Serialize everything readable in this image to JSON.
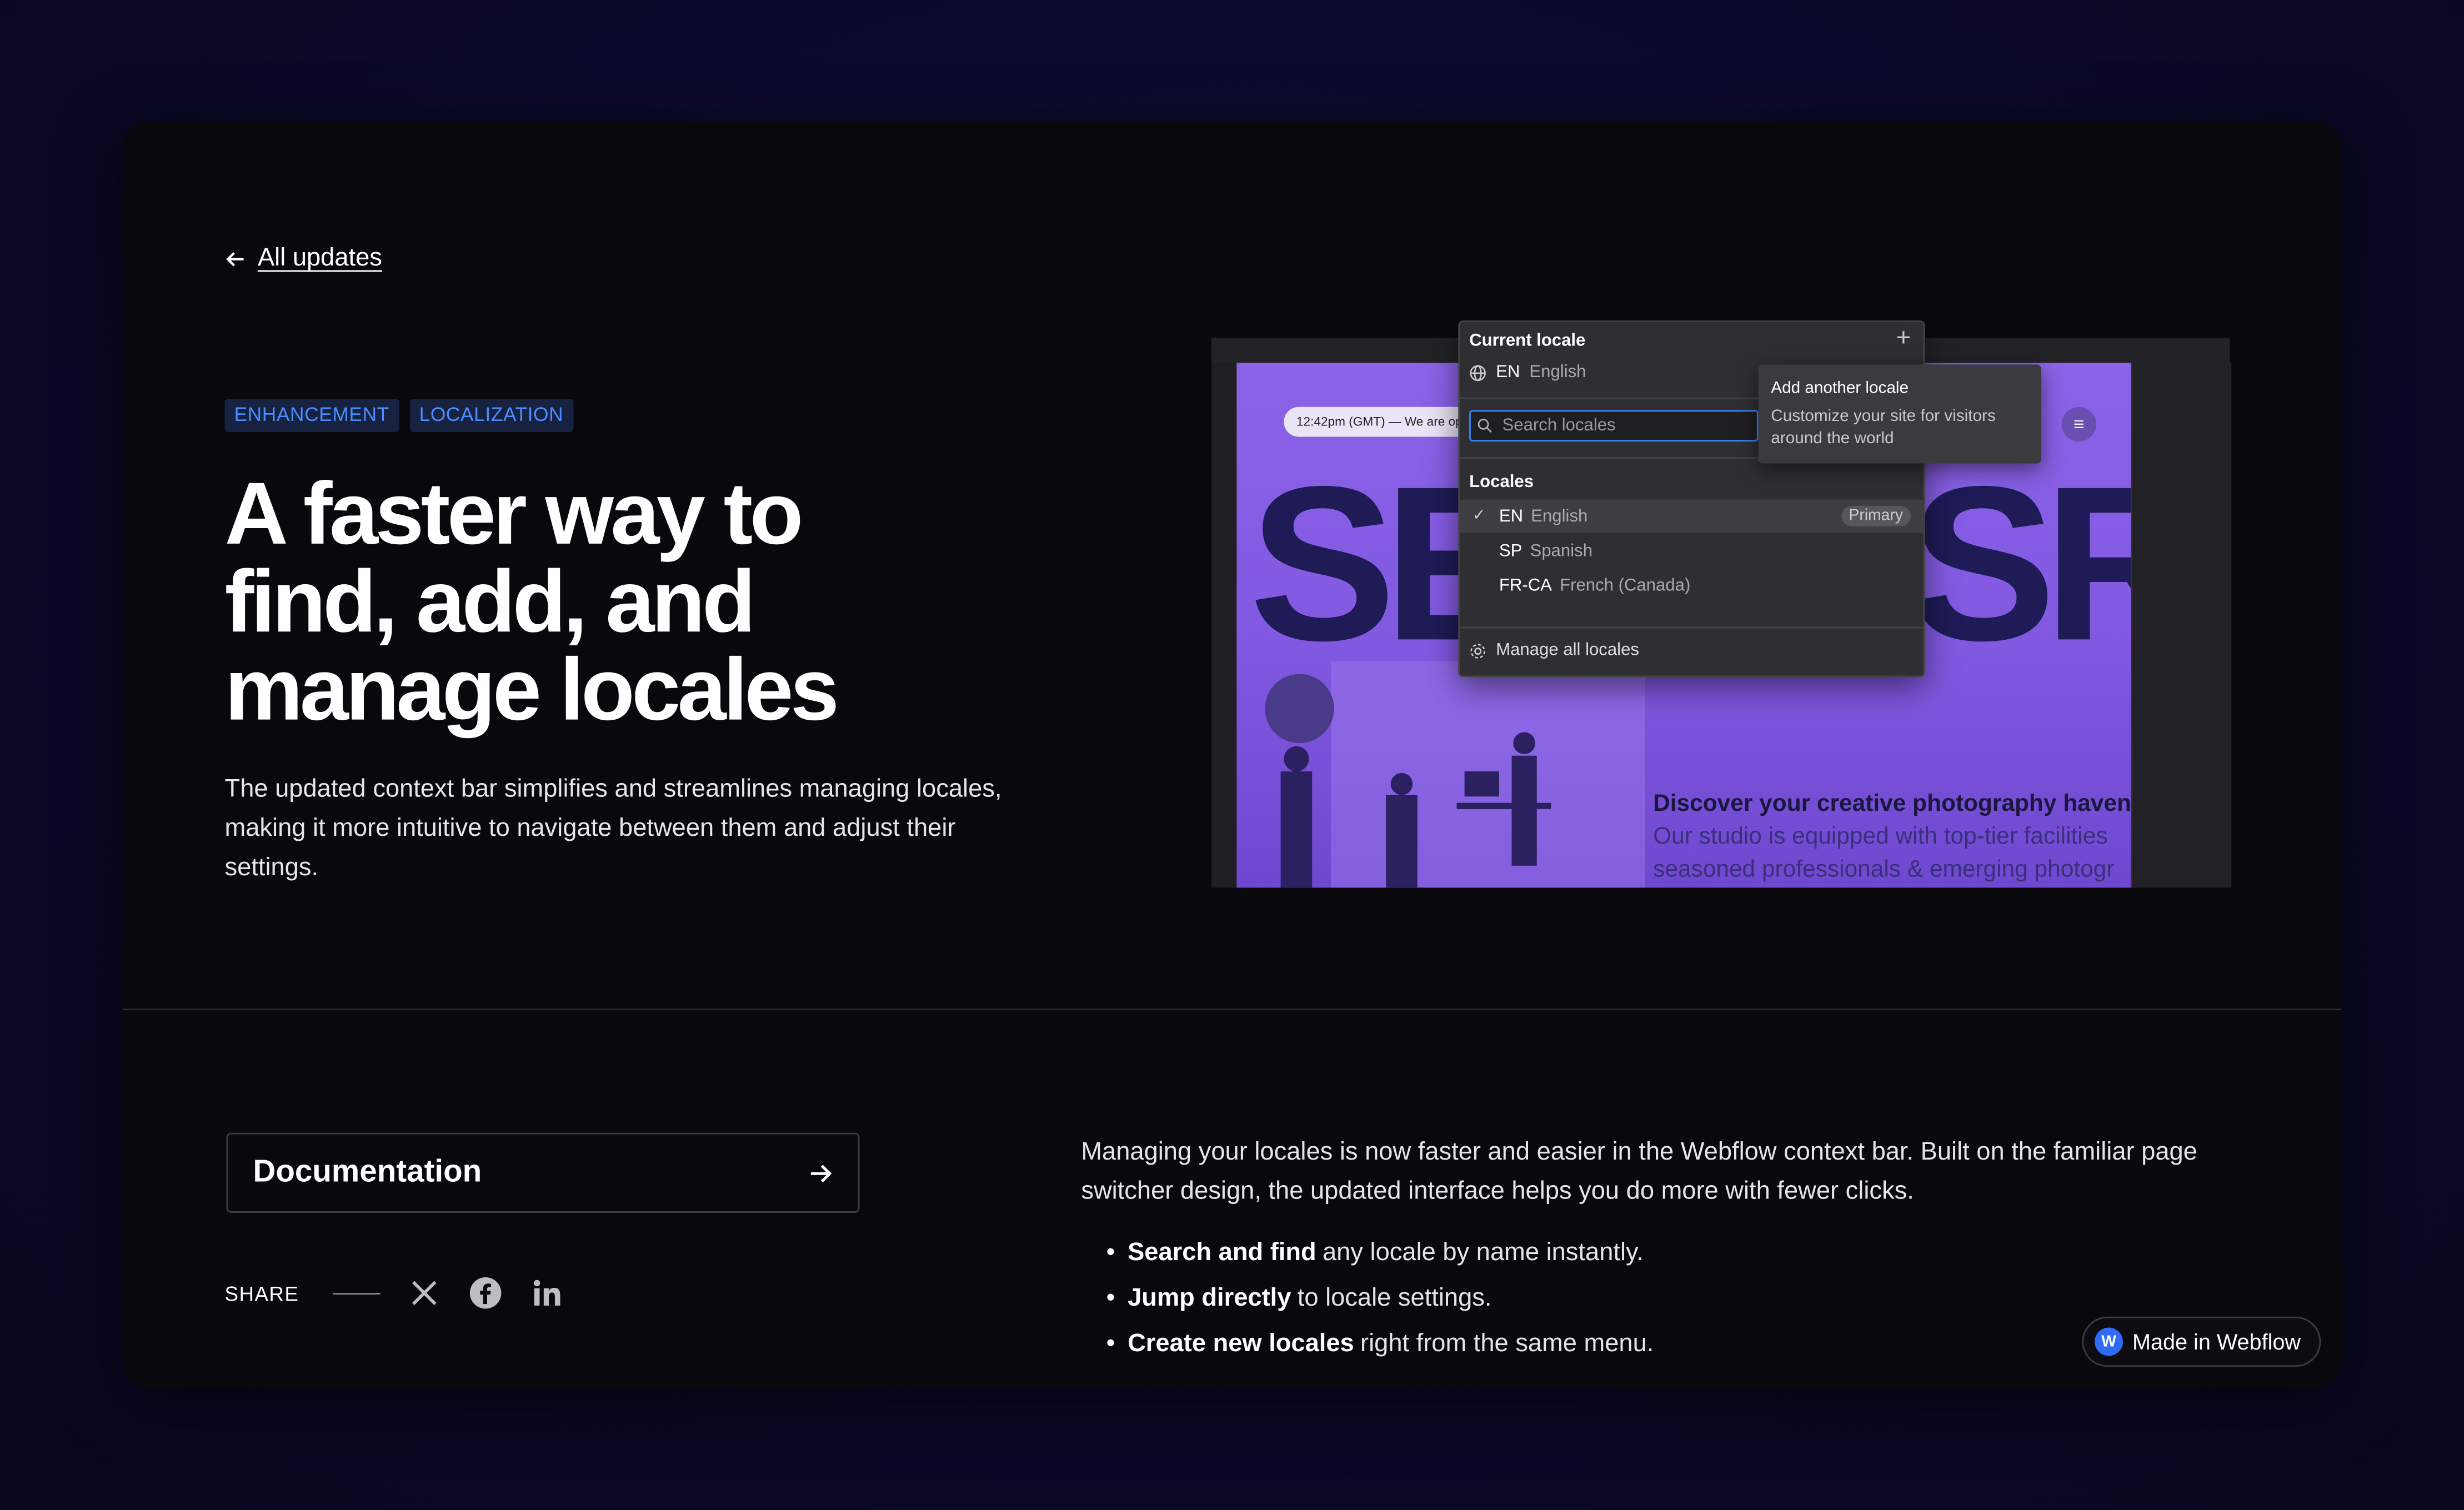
{
  "nav": {
    "back_label": "All updates"
  },
  "tags": [
    "ENHANCEMENT",
    "LOCALIZATION"
  ],
  "headline": "A faster way to find, add, and manage locales",
  "intro": "The updated context bar simplifies and streamlines managing locales, making it more intuitive to navigate between them and adjust their settings.",
  "screenshot": {
    "time_pill": "12:42pm (GMT) — We are op",
    "big_letters_left": "SE",
    "big_letters_right": "SR",
    "canvas_line1": "Discover your creative photography haven",
    "canvas_line2": "Our studio is equipped with top-tier facilities",
    "canvas_line3": "seasoned professionals & emerging photogr",
    "dropdown": {
      "title": "Current locale",
      "current_code": "EN",
      "current_name": "English",
      "search_placeholder": "Search locales",
      "locales_heading": "Locales",
      "items": [
        {
          "code": "EN",
          "name": "English",
          "badge": "Primary"
        },
        {
          "code": "SP",
          "name": "Spanish"
        },
        {
          "code": "FR-CA",
          "name": "French (Canada)"
        }
      ],
      "manage_label": "Manage all locales"
    },
    "tooltip": {
      "title": "Add another locale",
      "body": "Customize your site for visitors around the world"
    }
  },
  "documentation": {
    "label": "Documentation"
  },
  "share": {
    "label": "SHARE",
    "networks": [
      "x-icon",
      "facebook-icon",
      "linkedin-icon"
    ]
  },
  "body": {
    "paragraph": "Managing your locales is now faster and easier in the Webflow context bar. Built on the familiar page switcher design, the updated interface helps you do more with fewer clicks.",
    "bullets": [
      {
        "bold": "Search and find",
        "rest": "any locale by name instantly."
      },
      {
        "bold": "Jump directly",
        "rest": "to locale settings."
      },
      {
        "bold": "Create new locales",
        "rest": "right from the same menu."
      }
    ]
  },
  "badge": {
    "label": "Made in Webflow"
  },
  "colors": {
    "accent": "#4b8cff",
    "tag_bg": "#16223f",
    "card_bg": "#09080c",
    "page_bg": "#0a0a2a"
  }
}
